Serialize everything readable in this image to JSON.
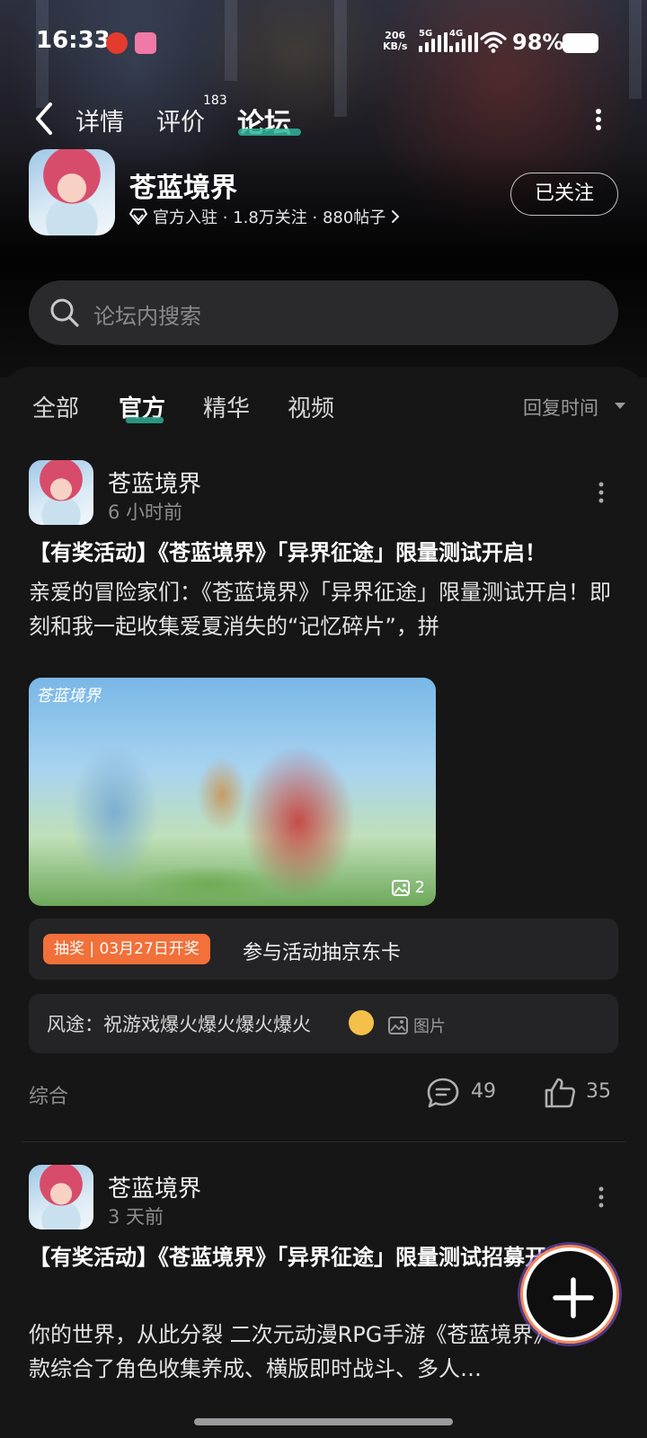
{
  "status_bar": {
    "time": "16:33",
    "net_speed_value": "206",
    "net_speed_unit": "KB/s",
    "network_5g": "5G",
    "network_4g": "4G",
    "battery": "98%"
  },
  "nav": {
    "tabs": [
      {
        "label": "详情"
      },
      {
        "label": "评价",
        "count": "183"
      },
      {
        "label": "论坛"
      }
    ],
    "active_tab": "论坛"
  },
  "game": {
    "name": "苍蓝境界",
    "meta": "官方入驻 · 1.8万关注 · 880帖子",
    "follow_button": "已关注"
  },
  "search": {
    "placeholder": "论坛内搜索"
  },
  "filters": {
    "tabs": [
      "全部",
      "官方",
      "精华",
      "视频"
    ],
    "active": "官方",
    "sort": "回复时间"
  },
  "posts": [
    {
      "author": "苍蓝境界",
      "time": "6 小时前",
      "title": "【有奖活动】《苍蓝境界》「异界征途」限量测试开启！",
      "body": "亲爱的冒险家们：《苍蓝境界》「异界征途」限量测试开启！即刻和我一起收集爱夏消失的“记忆碎片”，拼",
      "image_watermark": "苍蓝境界",
      "image_count": "2",
      "lottery_tag": "抽奖 | 03月27日开奖",
      "lottery_text": "参与活动抽京东卡",
      "top_comment": "风途：祝游戏爆火爆火爆火爆火",
      "top_comment_attachment": "图片",
      "category": "综合",
      "comments": "49",
      "likes": "35"
    },
    {
      "author": "苍蓝境界",
      "time": "3 天前",
      "title": "【有奖活动】《苍蓝境界》「异界征途」限量测试招募开启！",
      "body": "你的世界，从此分裂 二次元动漫RPG手游《苍蓝境界》是一款综合了角色收集养成、横版即时战斗、多人…"
    }
  ],
  "colors": {
    "accent": "#2fb59a",
    "lottery_tag": "#f2703a",
    "background": "#161616"
  }
}
